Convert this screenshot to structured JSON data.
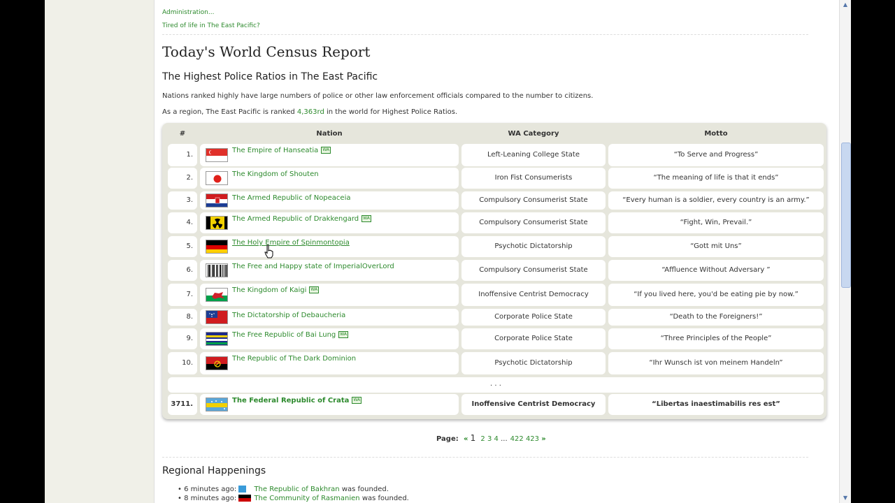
{
  "top_links": [
    "Administration...",
    "Tired of life in The East Pacific?"
  ],
  "report_title": "Today's World Census Report",
  "census_title": "The Highest Police Ratios in The East Pacific",
  "description": "Nations ranked highly have large numbers of police or other law enforcement officials compared to the number to citizens.",
  "region_rank": {
    "prefix": "As a region, The East Pacific is ranked ",
    "rank": "4,363rd",
    "suffix": " in the world for Highest Police Ratios."
  },
  "table": {
    "headers": [
      "#",
      "Nation",
      "WA Category",
      "Motto"
    ],
    "rows": [
      {
        "rank": "1.",
        "nation": "The Empire of Hanseatia",
        "wa": true,
        "category": "Left-Leaning College State",
        "motto": "“To Serve and Progress”",
        "flag": "singapore-flag"
      },
      {
        "rank": "2.",
        "nation": "The Kingdom of Shouten",
        "wa": false,
        "category": "Iron Fist Consumerists",
        "motto": "“The meaning of life is that it ends”",
        "flag": "japan-flag"
      },
      {
        "rank": "3.",
        "nation": "The Armed Republic of Nopeaceia",
        "wa": false,
        "category": "Compulsory Consumerist State",
        "motto": "“Every human is a soldier, every country is an army.”",
        "flag": "croatia-flag"
      },
      {
        "rank": "4.",
        "nation": "The Armed Republic of Drakkengard",
        "wa": true,
        "category": "Compulsory Consumerist State",
        "motto": "“Fight, Win, Prevail.”",
        "flag": "radiation-flag"
      },
      {
        "rank": "5.",
        "nation": "The Holy Empire of Spinmontopia",
        "wa": false,
        "category": "Psychotic Dictatorship",
        "motto": "“Gott mit Uns”",
        "flag": "germany-flag"
      },
      {
        "rank": "6.",
        "nation": "The Free and Happy state of ImperialOverLord",
        "wa": false,
        "category": "Compulsory Consumerist State",
        "motto": "“Affluence Without Adversary ”",
        "flag": "barcode-flag"
      },
      {
        "rank": "7.",
        "nation": "The Kingdom of Kaigi",
        "wa": true,
        "category": "Inoffensive Centrist Democracy",
        "motto": "“If you lived here, you'd be eating pie by now.”",
        "flag": "wales-flag"
      },
      {
        "rank": "8.",
        "nation": "The Dictatorship of Debaucheria",
        "wa": false,
        "category": "Corporate Police State",
        "motto": "“Death to the Foreigners!”",
        "flag": "samoa-flag"
      },
      {
        "rank": "9.",
        "nation": "The Free Republic of Bai Lung",
        "wa": true,
        "category": "Corporate Police State",
        "motto": "“Three Principles of the People”",
        "flag": "stripes-flag"
      },
      {
        "rank": "10.",
        "nation": "The Republic of The Dark Dominion",
        "wa": false,
        "category": "Psychotic Dictatorship",
        "motto": "“Ihr Wunsch ist von meinem Handeln”",
        "flag": "angola-flag"
      }
    ],
    "ellipsis": ". . .",
    "own_row": {
      "rank": "3711.",
      "nation": "The Federal Republic of Crata",
      "wa": true,
      "category": "Inoffensive Centrist Democracy",
      "motto": "“Libertas inaestimabilis res est”",
      "flag": "crata-flag"
    }
  },
  "wa_badge": "WA",
  "pager": {
    "label": "Page:",
    "prev": "«",
    "current": "1",
    "pages": [
      "2",
      "3",
      "4"
    ],
    "dots": "...",
    "end_pages": [
      "422",
      "423"
    ],
    "next": "»"
  },
  "happenings": {
    "title": "Regional Happenings",
    "items": [
      {
        "time": "6 minutes ago:",
        "nation": "The Republic of Bakhran",
        "text": " was founded."
      },
      {
        "time": "8 minutes ago:",
        "nation": "The Community of Rasmanien",
        "text": " was founded."
      }
    ]
  },
  "colors": {
    "link": "#2d8a2d",
    "table_bg": "#e6e6dc",
    "gutter": "#f0f0e8"
  }
}
